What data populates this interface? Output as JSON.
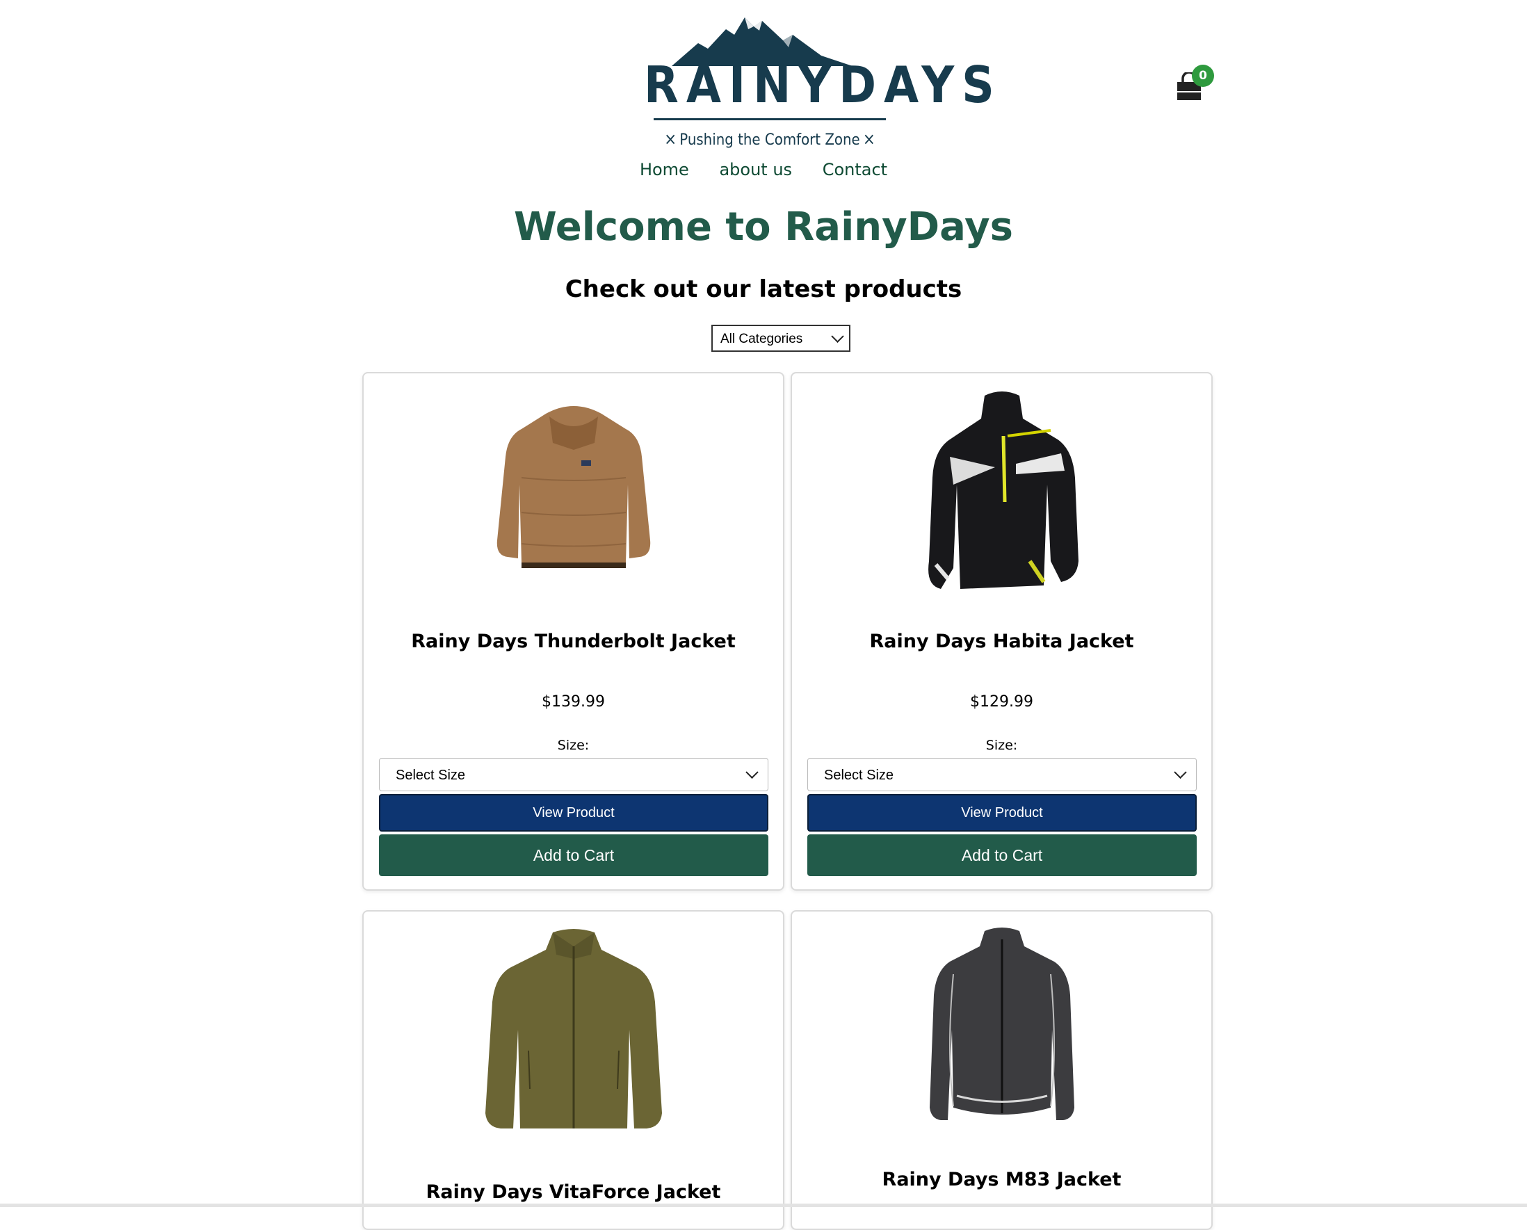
{
  "header": {
    "logo_name": "RAINYDAYS",
    "tagline": "Pushing the Comfort Zone",
    "tagline_mark": "×",
    "cart_count": "0",
    "colors": {
      "logo": "#173b4d",
      "nav": "#0e4a33",
      "badge": "#2e9a3e"
    }
  },
  "nav": {
    "items": [
      {
        "label": "Home"
      },
      {
        "label": "about us"
      },
      {
        "label": "Contact"
      }
    ]
  },
  "main": {
    "title": "Welcome to RainyDays",
    "subtitle": "Check out our latest products",
    "category_filter": {
      "selected": "All Categories"
    },
    "colors": {
      "title": "#225b4a",
      "view_button": "#0d3571",
      "cart_button": "#225b4a"
    }
  },
  "products": [
    {
      "name": "Rainy Days Thunderbolt Jacket",
      "price": "$139.99",
      "size_label": "Size:",
      "size_select": "Select Size",
      "view_label": "View Product",
      "cart_label": "Add to Cart",
      "image_icon": "brown-fleece-jacket"
    },
    {
      "name": "Rainy Days Habita Jacket",
      "price": "$129.99",
      "size_label": "Size:",
      "size_select": "Select Size",
      "view_label": "View Product",
      "cart_label": "Add to Cart",
      "image_icon": "black-moto-jacket"
    },
    {
      "name": "Rainy Days VitaForce Jacket",
      "image_icon": "olive-zip-jacket"
    },
    {
      "name": "Rainy Days M83 Jacket",
      "image_icon": "gray-shell-jacket"
    }
  ]
}
